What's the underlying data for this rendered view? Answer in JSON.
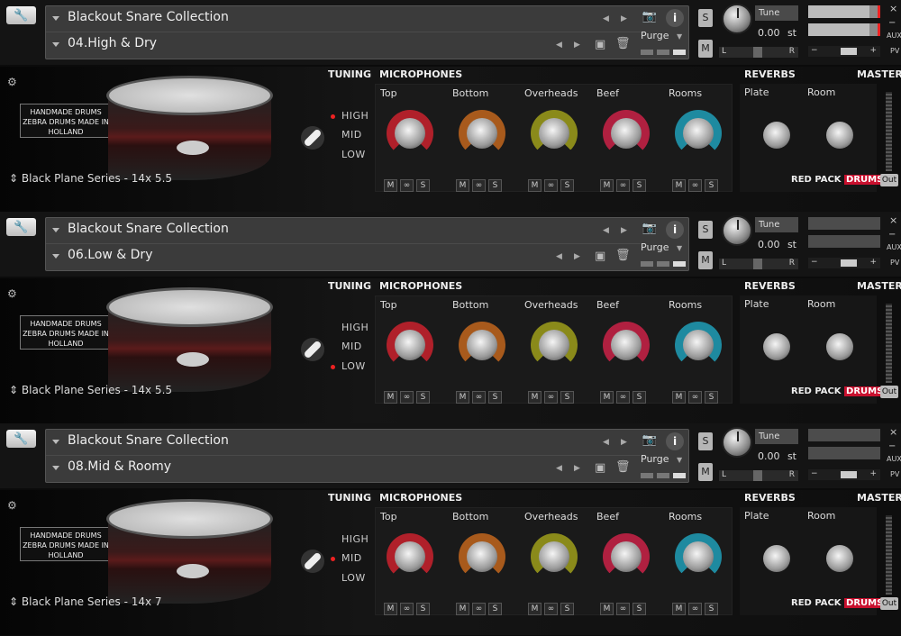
{
  "instruments": [
    {
      "collection": "Blackout Snare Collection",
      "preset": "04.High & Dry",
      "purge": "Purge",
      "solo": "S",
      "mute": "M",
      "tune_label": "Tune",
      "tune_value": "0.00",
      "tune_unit": "st",
      "pan_left": "L",
      "pan_right": "R",
      "aux": "AUX",
      "pv": "PV",
      "tuning_label": "TUNING",
      "tuning_options": [
        "HIGH",
        "MID",
        "LOW"
      ],
      "tuning_selected": "HIGH",
      "drum_preset": "Black Plane Series - 14x 5.5",
      "microphones_label": "MICROPHONES",
      "mics": [
        "Top",
        "Bottom",
        "Overheads",
        "Beef",
        "Rooms"
      ],
      "mic_buttons": [
        "M",
        "∞",
        "S"
      ],
      "reverbs_label": "REVERBS",
      "reverbs": [
        "Plate",
        "Room"
      ],
      "master_label": "MASTER",
      "brand": "RED PACK",
      "brand_accent": "DRUMS",
      "out": "Out",
      "logo": "HANDMADE DRUMS ZEBRA DRUMS MADE IN HOLLAND"
    },
    {
      "collection": "Blackout Snare Collection",
      "preset": "06.Low & Dry",
      "purge": "Purge",
      "solo": "S",
      "mute": "M",
      "tune_label": "Tune",
      "tune_value": "0.00",
      "tune_unit": "st",
      "pan_left": "L",
      "pan_right": "R",
      "aux": "AUX",
      "pv": "PV",
      "tuning_label": "TUNING",
      "tuning_options": [
        "HIGH",
        "MID",
        "LOW"
      ],
      "tuning_selected": "LOW",
      "drum_preset": "Black Plane Series - 14x 5.5",
      "microphones_label": "MICROPHONES",
      "mics": [
        "Top",
        "Bottom",
        "Overheads",
        "Beef",
        "Rooms"
      ],
      "mic_buttons": [
        "M",
        "∞",
        "S"
      ],
      "reverbs_label": "REVERBS",
      "reverbs": [
        "Plate",
        "Room"
      ],
      "master_label": "MASTER",
      "brand": "RED PACK",
      "brand_accent": "DRUMS",
      "out": "Out",
      "logo": "HANDMADE DRUMS ZEBRA DRUMS MADE IN HOLLAND"
    },
    {
      "collection": "Blackout Snare Collection",
      "preset": "08.Mid & Roomy",
      "purge": "Purge",
      "solo": "S",
      "mute": "M",
      "tune_label": "Tune",
      "tune_value": "0.00",
      "tune_unit": "st",
      "pan_left": "L",
      "pan_right": "R",
      "aux": "AUX",
      "pv": "PV",
      "tuning_label": "TUNING",
      "tuning_options": [
        "HIGH",
        "MID",
        "LOW"
      ],
      "tuning_selected": "MID",
      "drum_preset": "Black Plane Series - 14x 7",
      "microphones_label": "MICROPHONES",
      "mics": [
        "Top",
        "Bottom",
        "Overheads",
        "Beef",
        "Rooms"
      ],
      "mic_buttons": [
        "M",
        "∞",
        "S"
      ],
      "reverbs_label": "REVERBS",
      "reverbs": [
        "Plate",
        "Room"
      ],
      "master_label": "MASTER",
      "brand": "RED PACK",
      "brand_accent": "DRUMS",
      "out": "Out",
      "logo": "HANDMADE DRUMS ZEBRA DRUMS MADE IN HOLLAND"
    }
  ],
  "mic_colors": [
    "#b0202a",
    "#a85a1c",
    "#8a8a1a",
    "#b02040",
    "#1e8aa0"
  ],
  "icons": [
    "wrench-icon",
    "camera-icon",
    "info-icon",
    "save-icon",
    "trash-icon",
    "close-icon",
    "minimize-icon",
    "menu-triangle-icon"
  ]
}
